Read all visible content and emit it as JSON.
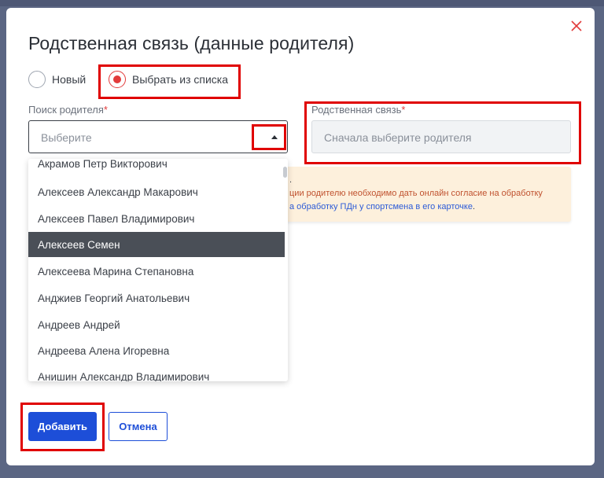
{
  "dialog": {
    "title": "Родственная связь (данные родителя)",
    "close_icon": "close-icon"
  },
  "radios": [
    {
      "label": "Новый",
      "checked": false
    },
    {
      "label": "Выбрать из списка",
      "checked": true
    }
  ],
  "parent_search": {
    "label": "Поиск родителя",
    "required_mark": "*",
    "placeholder": "Выберите"
  },
  "relation": {
    "label": "Родственная связь",
    "required_mark": "*",
    "placeholder": "Сначала выберите родителя"
  },
  "notice": {
    "line1_tail": ".",
    "line2": "ции родителю необходимо дать онлайн согласие на обработку",
    "line3_link": "а обработку ПДн у спортсмена в его карточке",
    "line3_tail": "."
  },
  "dropdown": {
    "partial_top": "Акрамов Петр Викторович",
    "options": [
      "Алексеев Александр Макарович",
      "Алексеев Павел Владимирович",
      "Алексеев Семен",
      "Алексеева Марина Степановна",
      "Анджиев Георгий Анатольевич",
      "Андреев Андрей",
      "Андреева Алена Игоревна",
      "Анишин Александр Владимирович"
    ],
    "active_option": "Алексеев Семен"
  },
  "buttons": {
    "add_label": "Добавить",
    "cancel_label": "Отмена"
  },
  "colors": {
    "accent": "#1d4ed8",
    "danger": "#e23b3b",
    "annotation": "#e00000",
    "overlay": "#5b6683"
  }
}
